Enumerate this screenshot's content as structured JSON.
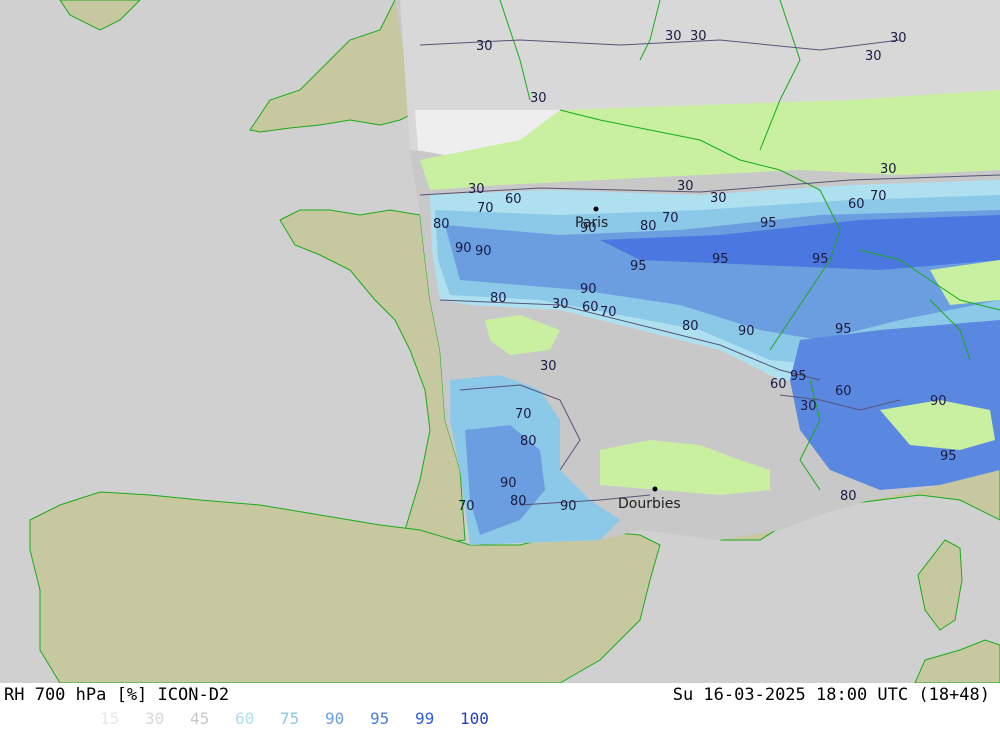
{
  "header": {
    "product": "RH 700 hPa [%] ICON-D2",
    "valid_time": "Su 16-03-2025 18:00 UTC (18+48)"
  },
  "legend": [
    {
      "label": "15",
      "color": "#e8e8e8"
    },
    {
      "label": "30",
      "color": "#d8d8d8"
    },
    {
      "label": "45",
      "color": "#c8c8c8"
    },
    {
      "label": "60",
      "color": "#aee0f0"
    },
    {
      "label": "75",
      "color": "#8cc8e8"
    },
    {
      "label": "90",
      "color": "#6aa0e0"
    },
    {
      "label": "95",
      "color": "#4a7ee0"
    },
    {
      "label": "99",
      "color": "#3060d8"
    },
    {
      "label": "100",
      "color": "#2040c8"
    }
  ],
  "places": {
    "paris": "Paris",
    "dourbies": "Dourbies"
  },
  "contour_labels": [
    "30",
    "30",
    "30",
    "30",
    "30",
    "30",
    "30",
    "30",
    "30",
    "60",
    "70",
    "30",
    "60",
    "70",
    "80",
    "90",
    "90",
    "80",
    "70",
    "90",
    "95",
    "95",
    "95",
    "95",
    "90",
    "80",
    "60",
    "30",
    "70",
    "80",
    "90",
    "95",
    "30",
    "60",
    "70",
    "80",
    "90",
    "95",
    "30",
    "60",
    "70",
    "80",
    "90",
    "80",
    "90",
    "95"
  ],
  "colors": {
    "land": "#c8c8a0",
    "sea": "#d0d0d0",
    "border": "#1aaa1a",
    "green_band": "#c8f0a0"
  }
}
